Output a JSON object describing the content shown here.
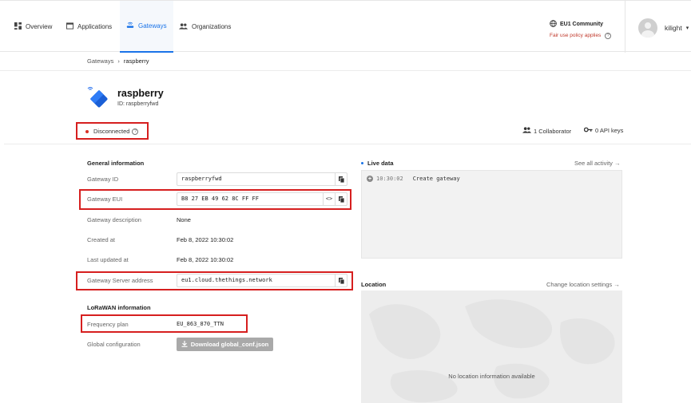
{
  "nav": {
    "overview": "Overview",
    "applications": "Applications",
    "gateways": "Gateways",
    "organizations": "Organizations",
    "network_name": "EU1 Community",
    "fair_use": "Fair use policy applies",
    "username": "kilight"
  },
  "breadcrumb": {
    "root": "Gateways",
    "current": "raspberry"
  },
  "gateway": {
    "name": "raspberry",
    "id_line": "ID: raspberryfwd",
    "status": "Disconnected",
    "collaborators": "1 Collaborator",
    "api_keys": "0 API keys"
  },
  "general": {
    "title": "General information",
    "gateway_id_label": "Gateway ID",
    "gateway_id_value": "raspberryfwd",
    "eui_label": "Gateway EUI",
    "eui_value": "B8 27 EB 49 62 8C FF FF",
    "description_label": "Gateway description",
    "description_value": "None",
    "created_label": "Created at",
    "created_value": "Feb 8, 2022 10:30:02",
    "updated_label": "Last updated at",
    "updated_value": "Feb 8, 2022 10:30:02",
    "server_label": "Gateway Server address",
    "server_value": "eu1.cloud.thethings.network"
  },
  "lorawan": {
    "title": "LoRaWAN information",
    "freq_label": "Frequency plan",
    "freq_value": "EU_863_870_TTN",
    "global_label": "Global configuration",
    "download_label": "Download global_conf.json"
  },
  "live": {
    "title": "Live data",
    "see_all": "See all activity →",
    "event_time": "10:30:02",
    "event_text": "Create gateway"
  },
  "location": {
    "title": "Location",
    "change": "Change location settings →",
    "empty": "No location information available"
  },
  "colors": {
    "accent": "#1a73e8",
    "annotation": "#d61f1f",
    "status": "#d93025"
  }
}
